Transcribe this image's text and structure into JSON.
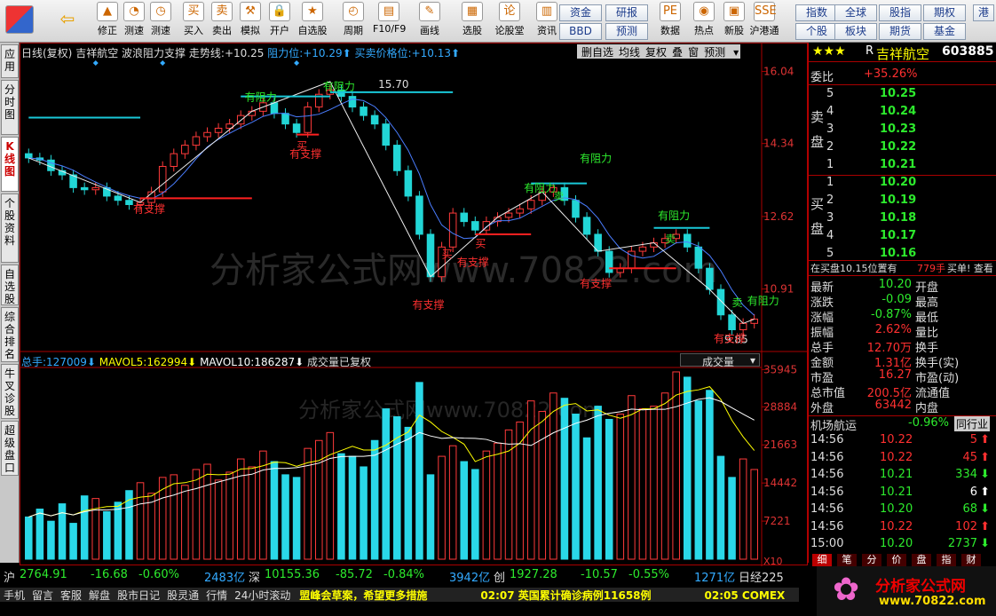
{
  "toolbar": {
    "buttons": [
      {
        "label": "修正",
        "icon": "up-arrow-icon",
        "g": "▲"
      },
      {
        "label": "测速",
        "icon": "clock-icon",
        "g": "◔"
      },
      {
        "label": "测速",
        "icon": "timer-icon",
        "g": "◷"
      },
      {
        "label": "买入",
        "icon": "buy-icon",
        "g": "买"
      },
      {
        "label": "卖出",
        "icon": "sell-icon",
        "g": "卖"
      },
      {
        "label": "模拟",
        "icon": "hammer-icon",
        "g": "⚒"
      },
      {
        "label": "开户",
        "icon": "lock-icon",
        "g": "🔒"
      },
      {
        "label": "自选股",
        "icon": "star-icon",
        "g": "★"
      },
      {
        "label": "周期",
        "icon": "cycle-icon",
        "g": "◴"
      },
      {
        "label": "F10/F9",
        "icon": "f10-icon",
        "g": "▤"
      },
      {
        "label": "画线",
        "icon": "pencil-icon",
        "g": "✎"
      },
      {
        "label": "选股",
        "icon": "filter-icon",
        "g": "▦"
      },
      {
        "label": "论股堂",
        "icon": "forum-icon",
        "g": "论"
      },
      {
        "label": "资讯",
        "icon": "news-icon",
        "g": "▥"
      },
      {
        "label": "数据",
        "icon": "pe-icon",
        "g": "PE"
      },
      {
        "label": "热点",
        "icon": "hotspot-icon",
        "g": "◉"
      },
      {
        "label": "新股",
        "icon": "newstock-icon",
        "g": "▣"
      },
      {
        "label": "沪港通",
        "icon": "hk-icon",
        "g": "SSE"
      }
    ],
    "back_icon": "back-arrow-icon",
    "right_buttons": [
      "资金",
      "研报",
      "指数",
      "全球",
      "股指",
      "期权",
      "BBD",
      "预测",
      "个股",
      "板块",
      "期货",
      "基金",
      "港"
    ]
  },
  "left_tabs": [
    "应用",
    "分时图",
    "K线图",
    "个股资料",
    "自选股",
    "综合排名",
    "牛叉诊股",
    "超级盘口"
  ],
  "chart": {
    "header": {
      "period": "日线(复权)",
      "name": "吉祥航空",
      "indicator": "波浪阻力支撑",
      "trend_label": "走势线:",
      "trend_value": "+10.25",
      "resist_label": "阻力位:",
      "resist_value": "+10.29",
      "buysell_label": "买卖价格位:",
      "buysell_value": "+10.13"
    },
    "top_buttons": [
      "删自选",
      "均线",
      "复权",
      "叠",
      "窗",
      "预测"
    ],
    "price_axis": [
      "16.04",
      "14.34",
      "12.62",
      "10.91"
    ],
    "vol_axis": [
      "35945",
      "28884",
      "21663",
      "14442",
      "7221"
    ],
    "x10": "X10",
    "annotations": {
      "high": "15.70",
      "low": "9.85",
      "resist": "有阻力",
      "support": "有支撑",
      "buy": "买",
      "sell": "卖"
    },
    "watermark": "分析家公式网www.70822.com",
    "vol_header": {
      "total_label": "总手:",
      "total": "127009",
      "ma5_label": "MAVOL5:",
      "ma5": "162994",
      "ma10_label": "MAVOL10:",
      "ma10": "186287",
      "note": "成交量已复权",
      "select": "成交量"
    }
  },
  "chart_data": {
    "type": "candlestick",
    "series": [
      {
        "name": "收盘",
        "values": [
          14.0,
          13.95,
          13.7,
          13.6,
          13.3,
          13.25,
          13.3,
          13.1,
          13.0,
          12.9,
          12.95,
          13.2,
          13.8,
          14.1,
          14.3,
          14.5,
          14.6,
          14.7,
          14.8,
          15.0,
          15.1,
          15.3,
          15.05,
          14.8,
          14.6,
          15.2,
          15.5,
          15.6,
          15.45,
          15.2,
          15.0,
          14.8,
          14.3,
          13.7,
          13.1,
          12.2,
          11.2,
          11.9,
          12.7,
          12.5,
          12.3,
          12.5,
          12.6,
          12.7,
          12.8,
          13.0,
          13.2,
          13.3,
          13.0,
          12.6,
          12.2,
          11.8,
          11.3,
          11.4,
          11.8,
          11.9,
          12.0,
          12.1,
          12.2,
          11.9,
          11.4,
          10.9,
          10.3,
          9.95,
          10.1,
          10.2
        ]
      },
      {
        "name": "MAVOL5",
        "values": []
      },
      {
        "name": "MAVOL10",
        "values": []
      }
    ],
    "volume": [
      8000,
      9500,
      7200,
      10500,
      6800,
      12000,
      11500,
      9000,
      10800,
      13000,
      14500,
      12500,
      15500,
      16000,
      14000,
      17000,
      18000,
      15000,
      16500,
      19000,
      17500,
      20500,
      18500,
      16000,
      15500,
      21000,
      22500,
      24000,
      20000,
      19500,
      17500,
      22500,
      28500,
      27000,
      25000,
      33500,
      16000,
      19500,
      21500,
      18500,
      17000,
      20500,
      22000,
      24500,
      26000,
      30000,
      28000,
      31500,
      30500,
      27500,
      23000,
      29000,
      26500,
      27500,
      31000,
      28500,
      29000,
      31500,
      35500,
      34500,
      30000,
      32000,
      19500,
      15500,
      19000,
      17000
    ],
    "price_range": [
      9.5,
      16.3
    ],
    "volume_range": [
      0,
      36000
    ]
  },
  "right_panel": {
    "stars": "★★★",
    "code_prefix": "R",
    "name": "吉祥航空",
    "code": "603885",
    "weibi_label": "委比",
    "weibi": "+35.26%",
    "sell_label": "卖盘",
    "buy_label": "买盘",
    "asks": [
      {
        "n": "5",
        "p": "10.25"
      },
      {
        "n": "4",
        "p": "10.24"
      },
      {
        "n": "3",
        "p": "10.23"
      },
      {
        "n": "2",
        "p": "10.22"
      },
      {
        "n": "1",
        "p": "10.21"
      }
    ],
    "bids": [
      {
        "n": "1",
        "p": "10.20"
      },
      {
        "n": "2",
        "p": "10.19"
      },
      {
        "n": "3",
        "p": "10.18"
      },
      {
        "n": "4",
        "p": "10.17"
      },
      {
        "n": "5",
        "p": "10.16"
      }
    ],
    "position_text": "在买盘10.15位置有",
    "position_qty": "779手",
    "position_tail": "买单! 查看",
    "stats": [
      {
        "l": "最新",
        "v": "10.20",
        "r": "开盘"
      },
      {
        "l": "涨跌",
        "v": "-0.09",
        "r": "最高"
      },
      {
        "l": "涨幅",
        "v": "-0.87%",
        "r": "最低"
      },
      {
        "l": "振幅",
        "v": "2.62%",
        "r": "量比"
      },
      {
        "l": "总手",
        "v": "12.70万",
        "r": "换手"
      },
      {
        "l": "金额",
        "v": "1.31亿",
        "r": "换手(实)"
      },
      {
        "l": "市盈",
        "v": "16.27",
        "r": "市盈(动)"
      },
      {
        "l": "总市值",
        "v": "200.5亿",
        "r": "流通值"
      },
      {
        "l": "外盘",
        "v": "63442",
        "r": "内盘"
      }
    ],
    "market_label": "机场航运",
    "market_pct": "-0.96%",
    "industry_btn": "同行业",
    "ticks": [
      {
        "t": "14:56",
        "p": "10.22",
        "q": "5",
        "d": "up"
      },
      {
        "t": "14:56",
        "p": "10.22",
        "q": "45",
        "d": "up"
      },
      {
        "t": "14:56",
        "p": "10.21",
        "q": "334",
        "d": "down"
      },
      {
        "t": "14:56",
        "p": "10.21",
        "q": "6",
        "d": "neutral"
      },
      {
        "t": "14:56",
        "p": "10.20",
        "q": "68",
        "d": "down"
      },
      {
        "t": "14:56",
        "p": "10.22",
        "q": "102",
        "d": "up"
      },
      {
        "t": "15:00",
        "p": "10.20",
        "q": "2737",
        "d": "down"
      }
    ],
    "tabs": [
      "细",
      "笔",
      "分",
      "价",
      "盘",
      "指",
      "财"
    ]
  },
  "bottom": {
    "sh": {
      "label": "沪",
      "idx": "2764.91",
      "chg": "-16.68",
      "pct": "-0.60%",
      "amt": "2483亿"
    },
    "sz": {
      "label": "深",
      "idx": "10155.36",
      "chg": "-85.72",
      "pct": "-0.84%",
      "amt": "3942亿"
    },
    "cy": {
      "label": "创",
      "idx": "1927.28",
      "chg": "-10.57",
      "pct": "-0.55%",
      "amt": "1271亿"
    },
    "extra": "日经225",
    "menu": [
      "手机",
      "留言",
      "客服",
      "解盘",
      "股市日记",
      "股灵通",
      "行情",
      "24小时滚动"
    ],
    "news1": "盟峰会草案，希望更多措施",
    "news2": "02:07 英国累计确诊病例11658例",
    "news3": "02:05 COMEX",
    "ad": "分析家公式网",
    "ad_url": "www.70822.com"
  }
}
